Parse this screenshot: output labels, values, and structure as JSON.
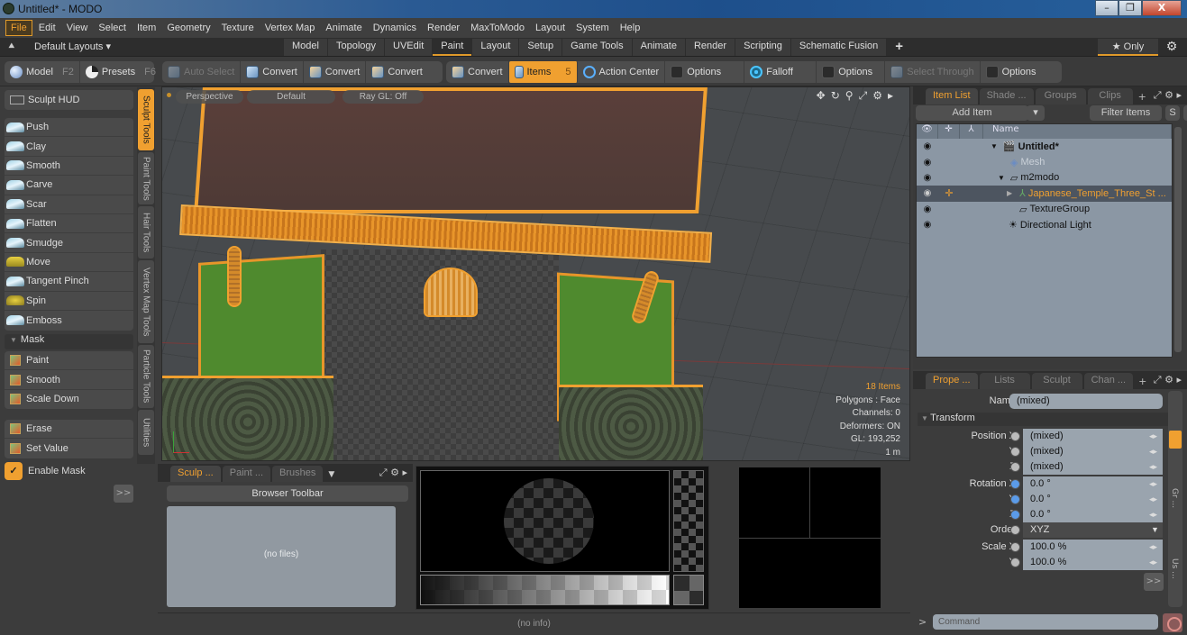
{
  "window": {
    "title": "Untitled* - MODO",
    "controls": [
      "minimize",
      "restore",
      "close"
    ]
  },
  "menu": [
    "File",
    "Edit",
    "View",
    "Select",
    "Item",
    "Geometry",
    "Texture",
    "Vertex Map",
    "Animate",
    "Dynamics",
    "Render",
    "MaxToModo",
    "Layout",
    "System",
    "Help"
  ],
  "menu_active": "File",
  "layouts": {
    "dropdown": "Default Layouts ▾",
    "tabs": [
      "Model",
      "Topology",
      "UVEdit",
      "Paint",
      "Layout",
      "Setup",
      "Game Tools",
      "Animate",
      "Render",
      "Scripting",
      "Schematic Fusion"
    ],
    "active": "Paint",
    "add": "+",
    "only": "★ Only"
  },
  "toolbar": {
    "model": {
      "label": "Model",
      "key": "F2"
    },
    "presets": {
      "label": "Presets",
      "key": "F6"
    },
    "auto_select": "Auto Select",
    "convert": [
      "Convert",
      "Convert",
      "Convert",
      "Convert"
    ],
    "items": {
      "label": "Items",
      "key": "5"
    },
    "action_center": "Action Center",
    "options1": "Options",
    "falloff": "Falloff",
    "options2": "Options",
    "select_through": "Select Through",
    "options3": "Options"
  },
  "left_panel": {
    "hud": "Sculpt HUD",
    "sculpt_tools": [
      "Push",
      "Clay",
      "Smooth",
      "Carve",
      "Scar",
      "Flatten",
      "Smudge",
      "Move",
      "Tangent Pinch",
      "Spin",
      "Emboss"
    ],
    "mask_header": "Mask",
    "mask_tools_a": [
      "Paint",
      "Smooth",
      "Scale Down"
    ],
    "mask_tools_b": [
      "Erase",
      "Set Value"
    ],
    "enable_mask": {
      "label": "Enable Mask",
      "checked": true
    },
    "more": ">>"
  },
  "vertical_tabs": [
    "Sculpt Tools",
    "Paint Tools",
    "Hair Tools",
    "Vertex Map Tools",
    "Particle Tools",
    "Utilities"
  ],
  "vertical_tabs_active": "Sculpt Tools",
  "viewport": {
    "view": "Perspective",
    "style": "Default",
    "raygl": "Ray GL: Off",
    "stats": {
      "items": "18 Items",
      "polygons": "Polygons : Face",
      "channels": "Channels: 0",
      "deformers": "Deformers: ON",
      "gl": "GL: 193,252",
      "scale": "1 m"
    }
  },
  "browser": {
    "tabs": [
      "Sculp ...",
      "Paint ...",
      "Brushes"
    ],
    "active": "Sculp ...",
    "toolbar": "Browser Toolbar",
    "empty": "(no files)"
  },
  "status": "(no info)",
  "item_list": {
    "tabs": [
      "Item List",
      "Shade ...",
      "Groups",
      "Clips"
    ],
    "active": "Item List",
    "add_item": "Add Item",
    "filter": "Filter Items",
    "s": "S",
    "f": "F",
    "column_name": "Name",
    "rows": [
      {
        "name": "Untitled*",
        "type": "scene",
        "bold": true
      },
      {
        "name": "Mesh",
        "type": "mesh",
        "dim": true
      },
      {
        "name": "m2modo",
        "type": "group"
      },
      {
        "name": "Japanese_Temple_Three_St ...",
        "type": "locator",
        "selected": true
      },
      {
        "name": "TextureGroup",
        "type": "group"
      },
      {
        "name": "Directional Light",
        "type": "light"
      }
    ]
  },
  "properties": {
    "tabs": [
      "Prope ...",
      "Lists",
      "Sculpt",
      "Chan ..."
    ],
    "active": "Prope ...",
    "name_label": "Name",
    "name_value": "(mixed)",
    "section": "Transform",
    "position": {
      "x_label": "Position X",
      "y_label": "Y",
      "z_label": "Z",
      "x": "(mixed)",
      "y": "(mixed)",
      "z": "(mixed)"
    },
    "rotation": {
      "x_label": "Rotation X",
      "y_label": "Y",
      "z_label": "Z",
      "x": "0.0 °",
      "y": "0.0 °",
      "z": "0.0 °"
    },
    "order": {
      "label": "Order",
      "value": "XYZ"
    },
    "scale": {
      "x_label": "Scale X",
      "y_label": "Y",
      "x": "100.0 %",
      "y": "100.0 %"
    },
    "more": ">>",
    "side_tabs": [
      "Gr ...",
      "Us ..."
    ]
  },
  "command": {
    "prompt": ">",
    "placeholder": "Command"
  }
}
